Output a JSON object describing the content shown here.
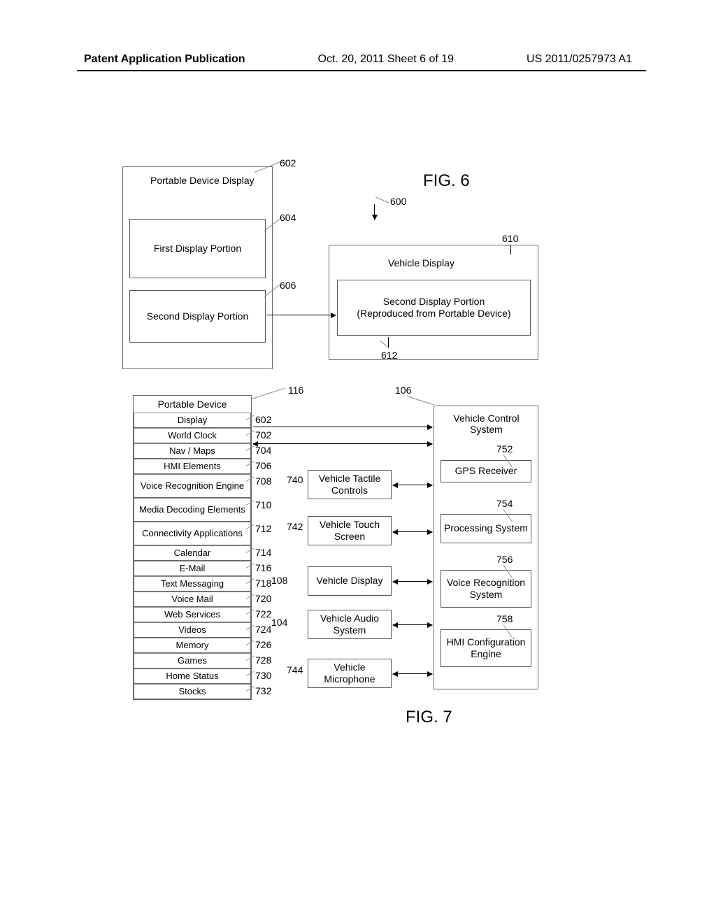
{
  "header": {
    "left": "Patent Application Publication",
    "center": "Oct. 20, 2011  Sheet 6 of 19",
    "right": "US 2011/0257973 A1"
  },
  "fig6": {
    "title": "FIG. 6",
    "ref_600": "600",
    "portable_display": "Portable Device Display",
    "ref_602": "602",
    "first_portion": "First Display Portion",
    "ref_604": "604",
    "second_portion": "Second Display Portion",
    "ref_606": "606",
    "vehicle_display": "Vehicle Display",
    "ref_610": "610",
    "second_repro": "Second Display Portion\n(Reproduced from Portable Device)",
    "ref_612": "612"
  },
  "fig7": {
    "title": "FIG. 7",
    "ref_116": "116",
    "pd_title": "Portable Device",
    "rows": [
      {
        "label": "Display",
        "ref": "602"
      },
      {
        "label": "World Clock",
        "ref": "702"
      },
      {
        "label": "Nav / Maps",
        "ref": "704"
      },
      {
        "label": "HMI Elements",
        "ref": "706"
      },
      {
        "label": "Voice Recognition Engine",
        "ref": "708",
        "tall": true
      },
      {
        "label": "Media Decoding Elements",
        "ref": "710",
        "tall": true
      },
      {
        "label": "Connectivity Applications",
        "ref": "712",
        "tall": true
      },
      {
        "label": "Calendar",
        "ref": "714"
      },
      {
        "label": "E-Mail",
        "ref": "716"
      },
      {
        "label": "Text Messaging",
        "ref": "718"
      },
      {
        "label": "Voice Mail",
        "ref": "720"
      },
      {
        "label": "Web Services",
        "ref": "722"
      },
      {
        "label": "Videos",
        "ref": "724"
      },
      {
        "label": "Memory",
        "ref": "726"
      },
      {
        "label": "Games",
        "ref": "728"
      },
      {
        "label": "Home Status",
        "ref": "730"
      },
      {
        "label": "Stocks",
        "ref": "732"
      }
    ],
    "mid": {
      "tactile": {
        "label": "Vehicle Tactile Controls",
        "ref": "740"
      },
      "touch": {
        "label": "Vehicle Touch Screen",
        "ref": "742"
      },
      "display": {
        "label": "Vehicle Display",
        "ref": "108"
      },
      "audio": {
        "label": "Vehicle Audio System",
        "ref": "104"
      },
      "mic": {
        "label": "Vehicle Microphone",
        "ref": "744"
      }
    },
    "ref_106": "106",
    "vcs": {
      "title": "Vehicle Control System",
      "gps": {
        "label": "GPS Receiver",
        "ref": "752"
      },
      "proc": {
        "label": "Processing System",
        "ref": "754"
      },
      "voice": {
        "label": "Voice Recognition System",
        "ref": "756"
      },
      "hmi": {
        "label": "HMI Configuration Engine",
        "ref": "758"
      }
    }
  }
}
